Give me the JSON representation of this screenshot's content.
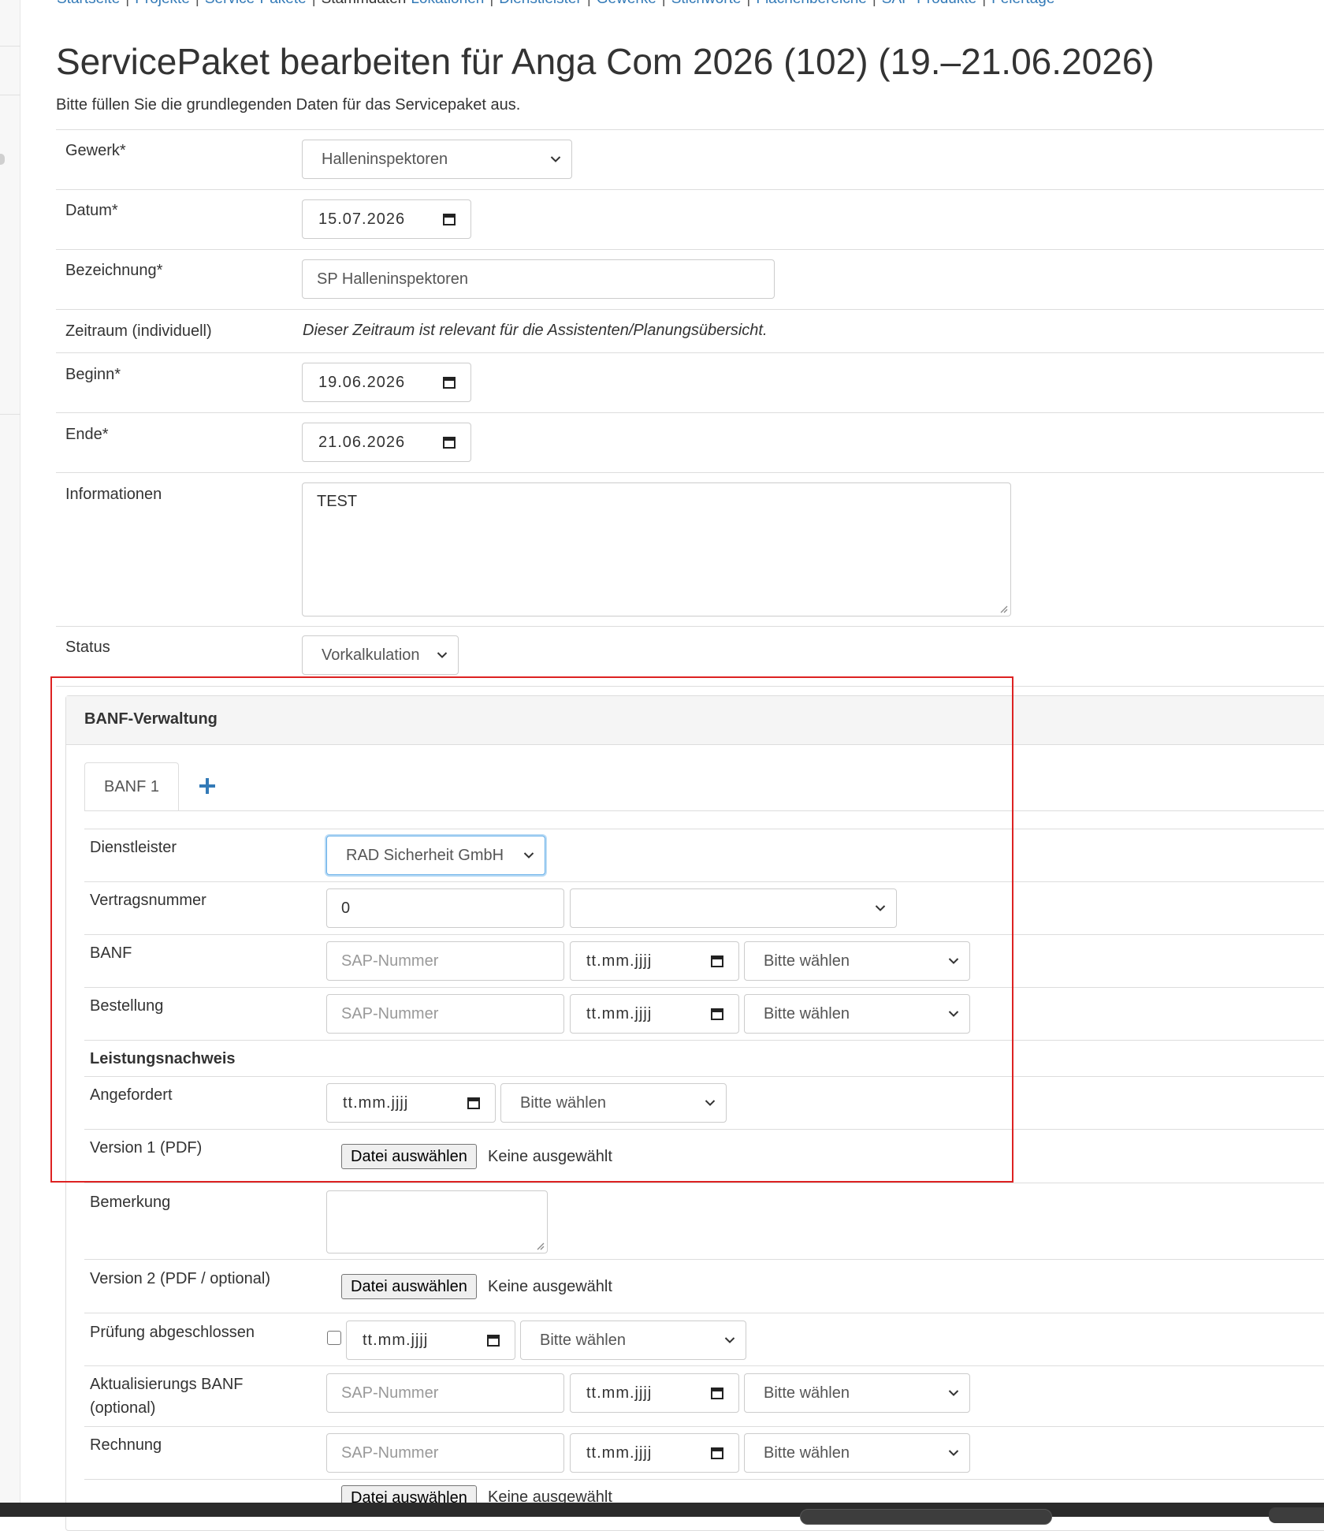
{
  "breadcrumb": {
    "items": [
      "Startseite",
      "Projekte",
      "Service-Pakete",
      "Stammdaten",
      "Lokationen",
      "Dienstleister",
      "Gewerke",
      "Stichworte",
      "Flächenbereiche",
      "SAP-Produkte",
      "Feiertage"
    ],
    "active_index": 3
  },
  "page": {
    "title": "ServicePaket bearbeiten für Anga Com 2026 (102) (19.–21.06.2026)",
    "subtitle": "Bitte füllen Sie die grundlegenden Daten für das Servicepaket aus."
  },
  "form": {
    "gewerk_label": "Gewerk*",
    "gewerk_value": "Halleninspektoren",
    "datum_label": "Datum*",
    "datum_value": "15.07.2026",
    "bezeichnung_label": "Bezeichnung*",
    "bezeichnung_value": "SP Halleninspektoren",
    "zeitraum_label": "Zeitraum (individuell)",
    "zeitraum_note": "Dieser Zeitraum ist relevant für die Assistenten/Planungsübersicht.",
    "beginn_label": "Beginn*",
    "beginn_value": "19.06.2026",
    "ende_label": "Ende*",
    "ende_value": "21.06.2026",
    "informationen_label": "Informationen",
    "informationen_value": "TEST",
    "status_label": "Status",
    "status_value": "Vorkalkulation"
  },
  "banf": {
    "panel_title": "BANF-Verwaltung",
    "tab_label": "BANF 1",
    "dienstleister_label": "Dienstleister",
    "dienstleister_value": "RAD Sicherheit GmbH",
    "vertragsnummer_label": "Vertragsnummer",
    "vertragsnummer_value": "0",
    "vertragsnummer_select": "",
    "banf_label": "BANF",
    "bestellung_label": "Bestellung",
    "sap_placeholder": "SAP-Nummer",
    "date_placeholder": "tt.mm.jjjj",
    "select_placeholder": "Bitte wählen",
    "leistungsnachweis_label": "Leistungsnachweis",
    "angefordert_label": "Angefordert",
    "version1_label": "Version 1 (PDF)",
    "file_button": "Datei auswählen",
    "file_none": "Keine ausgewählt",
    "bemerkung_label": "Bemerkung",
    "version2_label": "Version 2 (PDF / optional)",
    "pruefung_label": "Prüfung abgeschlossen",
    "aktualisierung_label_1": "Aktualisierungs BANF",
    "aktualisierung_label_2": "(optional)",
    "rechnung_label": "Rechnung"
  },
  "colors": {
    "link": "#337ab7",
    "highlight_border": "#dd2222",
    "plus_icon": "#337ab7",
    "focus_border": "#66afe9"
  }
}
